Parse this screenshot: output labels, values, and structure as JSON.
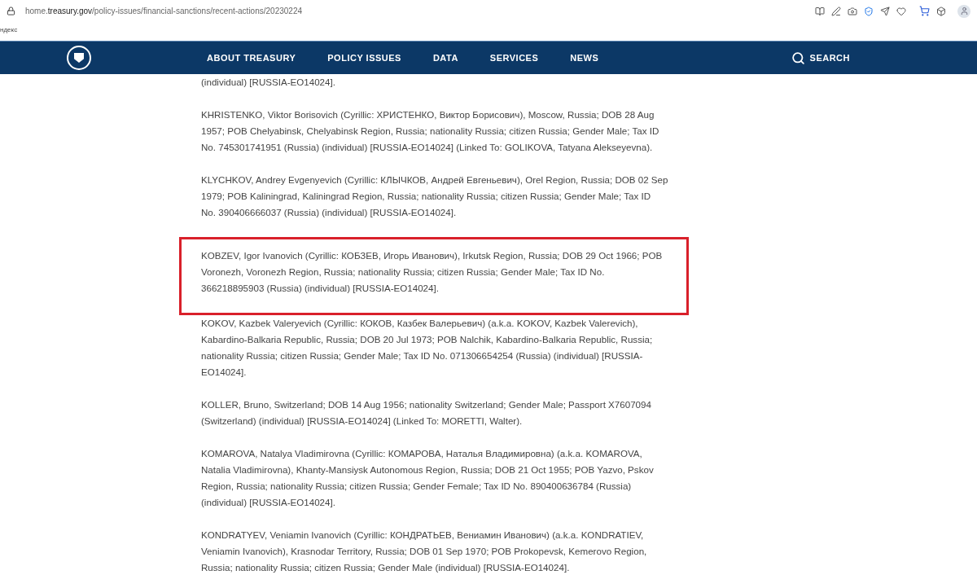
{
  "address_bar": {
    "url_host_prefix": "home.",
    "url_host": "treasury.gov",
    "url_path": "/policy-issues/financial-sanctions/recent-actions/20230224"
  },
  "bookmarks": [
    "ндекс"
  ],
  "nav": {
    "items": [
      "ABOUT TREASURY",
      "POLICY ISSUES",
      "DATA",
      "SERVICES",
      "NEWS"
    ],
    "search": "SEARCH"
  },
  "entries": [
    {
      "highlighted": false,
      "lines": [
        "(individual) [RUSSIA-EO14024]."
      ]
    },
    {
      "highlighted": false,
      "lines": [
        "KHRISTENKO, Viktor Borisovich (Cyrillic: ХРИСТЕНКО, Виктор Борисович), Moscow, Russia; DOB 28 Aug",
        "1957; POB Chelyabinsk, Chelyabinsk Region, Russia; nationality Russia; citizen Russia; Gender Male; Tax ID",
        "No. 745301741951 (Russia) (individual) [RUSSIA-EO14024] (Linked To: GOLIKOVA, Tatyana Alekseyevna)."
      ]
    },
    {
      "highlighted": false,
      "lines": [
        "KLYCHKOV, Andrey Evgenyevich (Cyrillic: КЛЫЧКОВ, Андрей Евгеньевич), Orel Region, Russia; DOB 02 Sep",
        "1979; POB Kaliningrad, Kaliningrad Region, Russia; nationality Russia; citizen Russia; Gender Male; Tax ID",
        "No. 390406666037 (Russia) (individual) [RUSSIA-EO14024]."
      ]
    },
    {
      "highlighted": true,
      "lines": [
        "KOBZEV, Igor Ivanovich (Cyrillic: КОБЗЕВ, Игорь Иванович), Irkutsk Region, Russia; DOB 29 Oct 1966; POB",
        "Voronezh, Voronezh Region, Russia; nationality Russia; citizen Russia; Gender Male; Tax ID No.",
        "366218895903 (Russia) (individual) [RUSSIA-EO14024]."
      ]
    },
    {
      "highlighted": false,
      "lines": [
        "KOKOV, Kazbek Valeryevich (Cyrillic: КОКОВ, Казбек Валерьевич) (a.k.a. KOKOV, Kazbek Valerevich),",
        "Kabardino-Balkaria Republic, Russia; DOB 20 Jul 1973; POB Nalchik, Kabardino-Balkaria Republic, Russia;",
        "nationality Russia; citizen Russia; Gender Male; Tax ID No. 071306654254 (Russia) (individual) [RUSSIA-",
        "EO14024]."
      ]
    },
    {
      "highlighted": false,
      "lines": [
        "KOLLER, Bruno, Switzerland; DOB 14 Aug 1956; nationality Switzerland; Gender Male; Passport X7607094",
        "(Switzerland) (individual) [RUSSIA-EO14024] (Linked To: MORETTI, Walter)."
      ]
    },
    {
      "highlighted": false,
      "lines": [
        "KOMAROVA, Natalya Vladimirovna (Cyrillic: КОМАРОВА, Наталья Владимировна) (a.k.a. KOMAROVA,",
        "Natalia Vladimirovna), Khanty-Mansiysk Autonomous Region, Russia; DOB 21 Oct 1955; POB Yazvo, Pskov",
        "Region, Russia; nationality Russia; citizen Russia; Gender Female; Tax ID No. 890400636784 (Russia)",
        "(individual) [RUSSIA-EO14024]."
      ]
    },
    {
      "highlighted": false,
      "lines": [
        "KONDRATYEV, Veniamin Ivanovich (Cyrillic: КОНДРАТЬЕВ, Вениамин Иванович) (a.k.a. KONDRATIEV,",
        "Veniamin Ivanovich), Krasnodar Territory, Russia; DOB 01 Sep 1970; POB Prokopevsk, Kemerovo Region,",
        "Russia; nationality Russia; citizen Russia; Gender Male (individual) [RUSSIA-EO14024]."
      ]
    }
  ]
}
